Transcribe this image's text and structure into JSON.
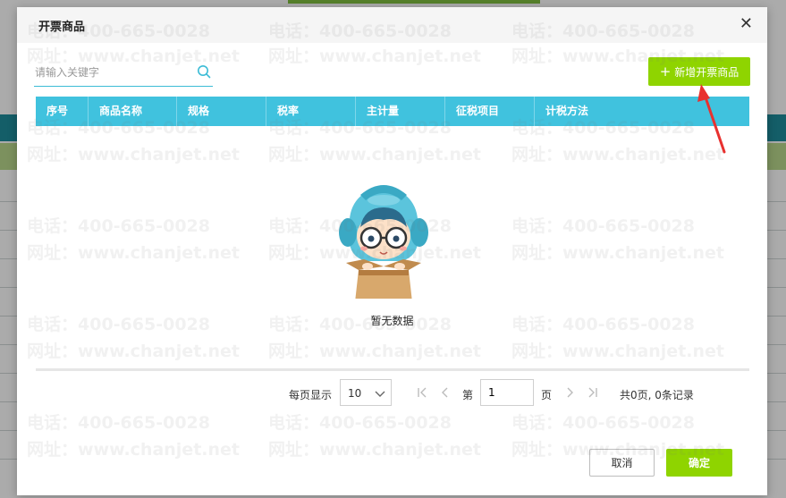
{
  "dialog": {
    "title": "开票商品",
    "close_glyph": "✕"
  },
  "search": {
    "placeholder": "请输入关键字",
    "value": "",
    "icon": "search-icon"
  },
  "toolbar": {
    "add_label": "新增开票商品",
    "add_icon": "plus-icon"
  },
  "table": {
    "columns": [
      "序号",
      "商品名称",
      "规格",
      "税率",
      "主计量",
      "征税项目",
      "计税方法"
    ],
    "empty_text": "暂无数据"
  },
  "pager": {
    "per_page_label": "每页显示",
    "page_size": "10",
    "page_prefix": "第",
    "current_page": "1",
    "page_suffix": "页",
    "summary": "共0页, 0条记录"
  },
  "footer": {
    "cancel_label": "取消",
    "ok_label": "确定"
  },
  "watermark": {
    "phone": "电话：400-665-0028",
    "site": "网址：www.chanjet.net"
  },
  "colors": {
    "accent_green": "#8fd400",
    "table_header": "#40c2de",
    "annotation_red": "#e8312f"
  }
}
